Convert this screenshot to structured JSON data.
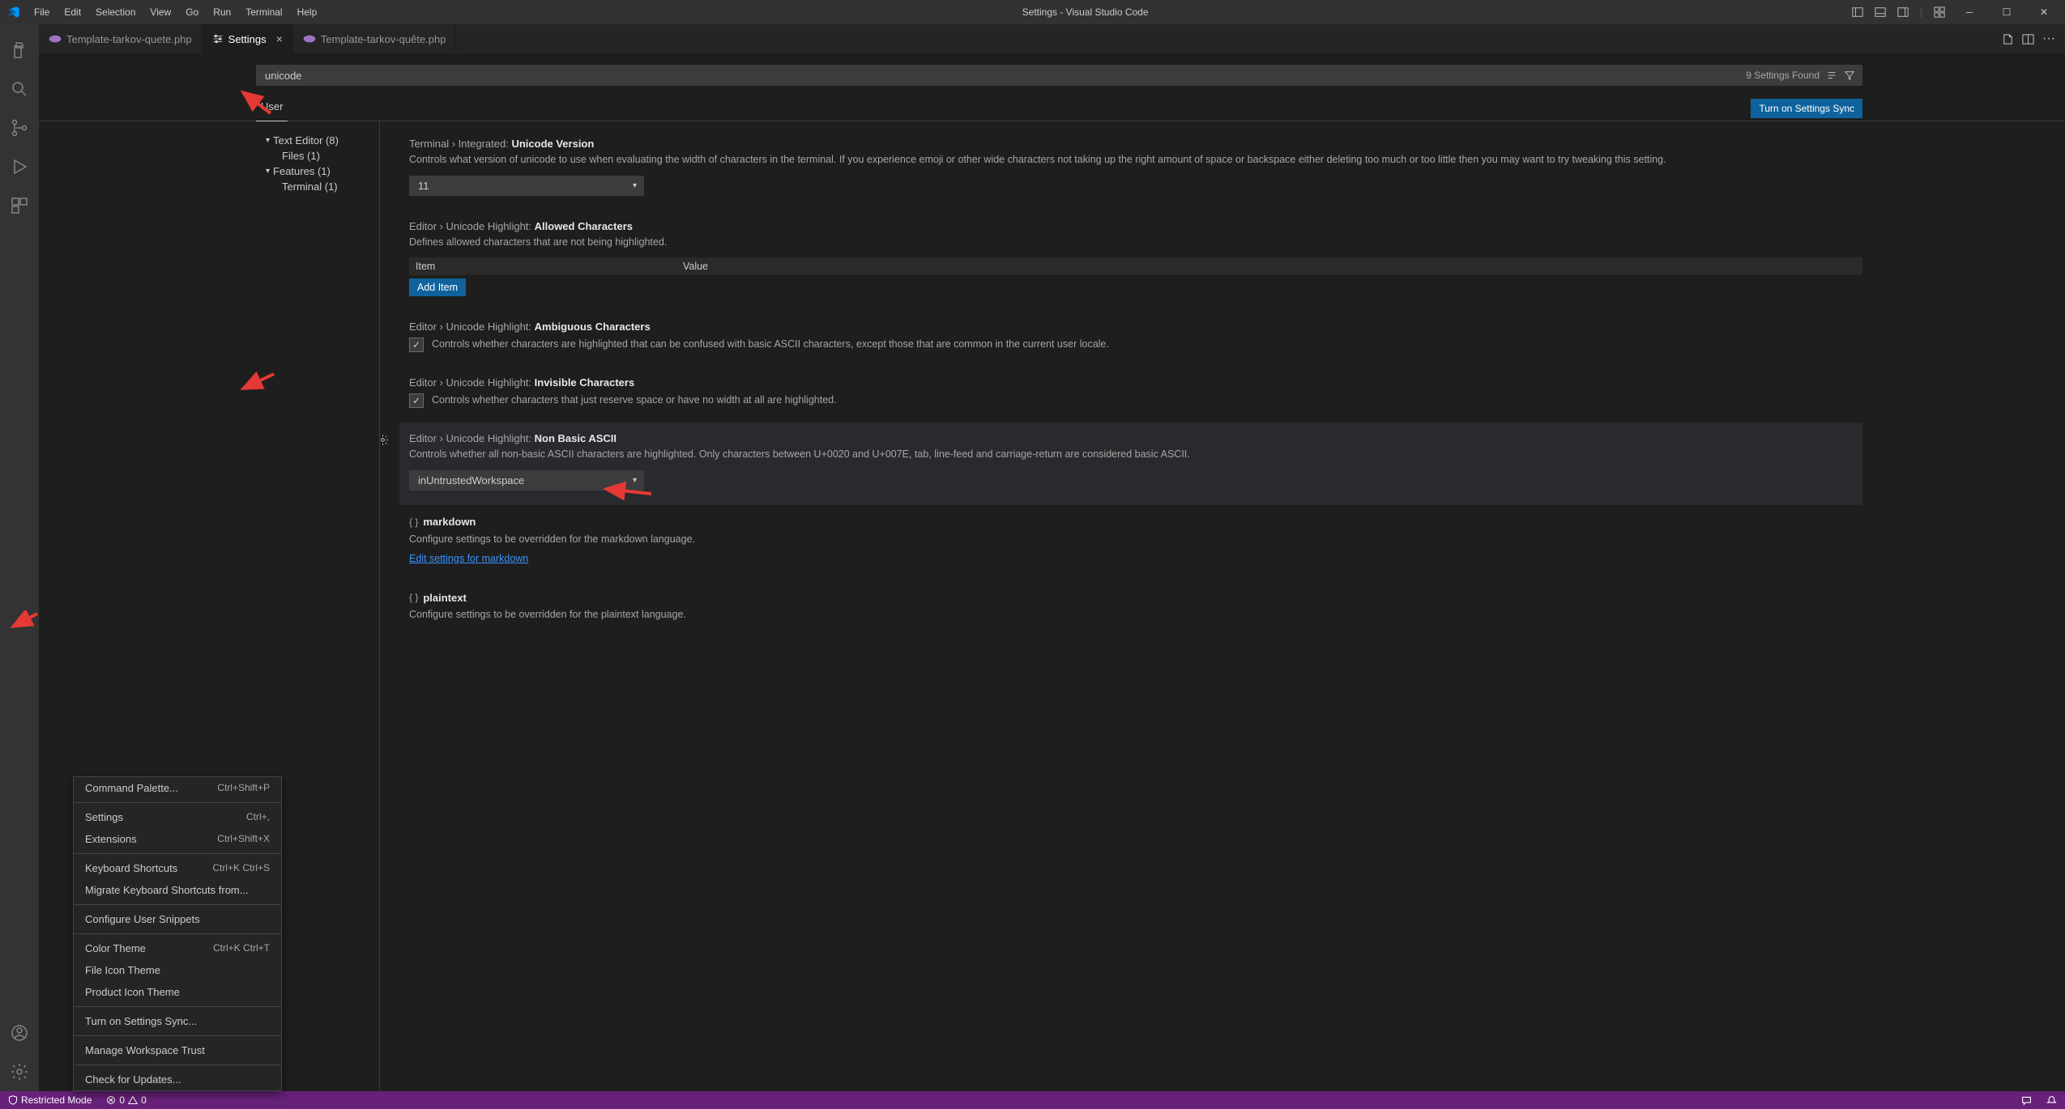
{
  "titlebar": {
    "menus": [
      "File",
      "Edit",
      "Selection",
      "View",
      "Go",
      "Run",
      "Terminal",
      "Help"
    ],
    "title": "Settings - Visual Studio Code"
  },
  "tabs": {
    "items": [
      {
        "label": "Template-tarkov-quete.php",
        "icon": "php",
        "active": false
      },
      {
        "label": "Settings",
        "icon": "settings",
        "active": true
      },
      {
        "label": "Template-tarkov-quête.php",
        "icon": "php",
        "active": false
      }
    ]
  },
  "search": {
    "value": "unicode",
    "found_label": "9 Settings Found"
  },
  "scope": {
    "tab_label": "User",
    "sync_button": "Turn on Settings Sync"
  },
  "toc": {
    "items": [
      {
        "label": "Text Editor (8)",
        "expandable": true
      },
      {
        "label": "Files (1)",
        "child": true
      },
      {
        "label": "Features (1)",
        "expandable": true
      },
      {
        "label": "Terminal (1)",
        "child": true
      }
    ]
  },
  "settings": [
    {
      "id": "terminal_unicode",
      "prefix": "Terminal › Integrated: ",
      "name": "Unicode Version",
      "desc": "Controls what version of unicode to use when evaluating the width of characters in the terminal. If you experience emoji or other wide characters not taking up the right amount of space or backspace either deleting too much or too little then you may want to try tweaking this setting.",
      "type": "dropdown",
      "value": "11"
    },
    {
      "id": "allowed_chars",
      "prefix": "Editor › Unicode Highlight: ",
      "name": "Allowed Characters",
      "desc": "Defines allowed characters that are not being highlighted.",
      "type": "table",
      "col_item": "Item",
      "col_value": "Value",
      "add_label": "Add Item"
    },
    {
      "id": "ambiguous",
      "prefix": "Editor › Unicode Highlight: ",
      "name": "Ambiguous Characters",
      "type": "checkbox",
      "checked": true,
      "desc": "Controls whether characters are highlighted that can be confused with basic ASCII characters, except those that are common in the current user locale."
    },
    {
      "id": "invisible",
      "prefix": "Editor › Unicode Highlight: ",
      "name": "Invisible Characters",
      "type": "checkbox",
      "checked": true,
      "desc": "Controls whether characters that just reserve space or have no width at all are highlighted."
    },
    {
      "id": "nonbasic",
      "prefix": "Editor › Unicode Highlight: ",
      "name": "Non Basic ASCII",
      "type": "dropdown",
      "highlight": true,
      "desc": "Controls whether all non-basic ASCII characters are highlighted. Only characters between U+0020 and U+007E, tab, line-feed and carriage-return are considered basic ASCII.",
      "value": "inUntrustedWorkspace"
    },
    {
      "id": "lang_markdown",
      "type": "lang",
      "lang": "markdown",
      "desc": "Configure settings to be overridden for the markdown language.",
      "link": "Edit settings for markdown"
    },
    {
      "id": "lang_plaintext",
      "type": "lang",
      "lang": "plaintext",
      "desc": "Configure settings to be overridden for the plaintext language."
    }
  ],
  "context_menu": {
    "items": [
      {
        "label": "Command Palette...",
        "shortcut": "Ctrl+Shift+P"
      },
      {
        "sep": true
      },
      {
        "label": "Settings",
        "shortcut": "Ctrl+,"
      },
      {
        "label": "Extensions",
        "shortcut": "Ctrl+Shift+X"
      },
      {
        "sep": true
      },
      {
        "label": "Keyboard Shortcuts",
        "shortcut": "Ctrl+K Ctrl+S"
      },
      {
        "label": "Migrate Keyboard Shortcuts from..."
      },
      {
        "sep": true
      },
      {
        "label": "Configure User Snippets"
      },
      {
        "sep": true
      },
      {
        "label": "Color Theme",
        "shortcut": "Ctrl+K Ctrl+T"
      },
      {
        "label": "File Icon Theme"
      },
      {
        "label": "Product Icon Theme"
      },
      {
        "sep": true
      },
      {
        "label": "Turn on Settings Sync..."
      },
      {
        "sep": true
      },
      {
        "label": "Manage Workspace Trust"
      },
      {
        "sep": true
      },
      {
        "label": "Check for Updates..."
      }
    ]
  },
  "statusbar": {
    "restricted": "Restricted Mode",
    "errors": "0",
    "warnings": "0"
  }
}
